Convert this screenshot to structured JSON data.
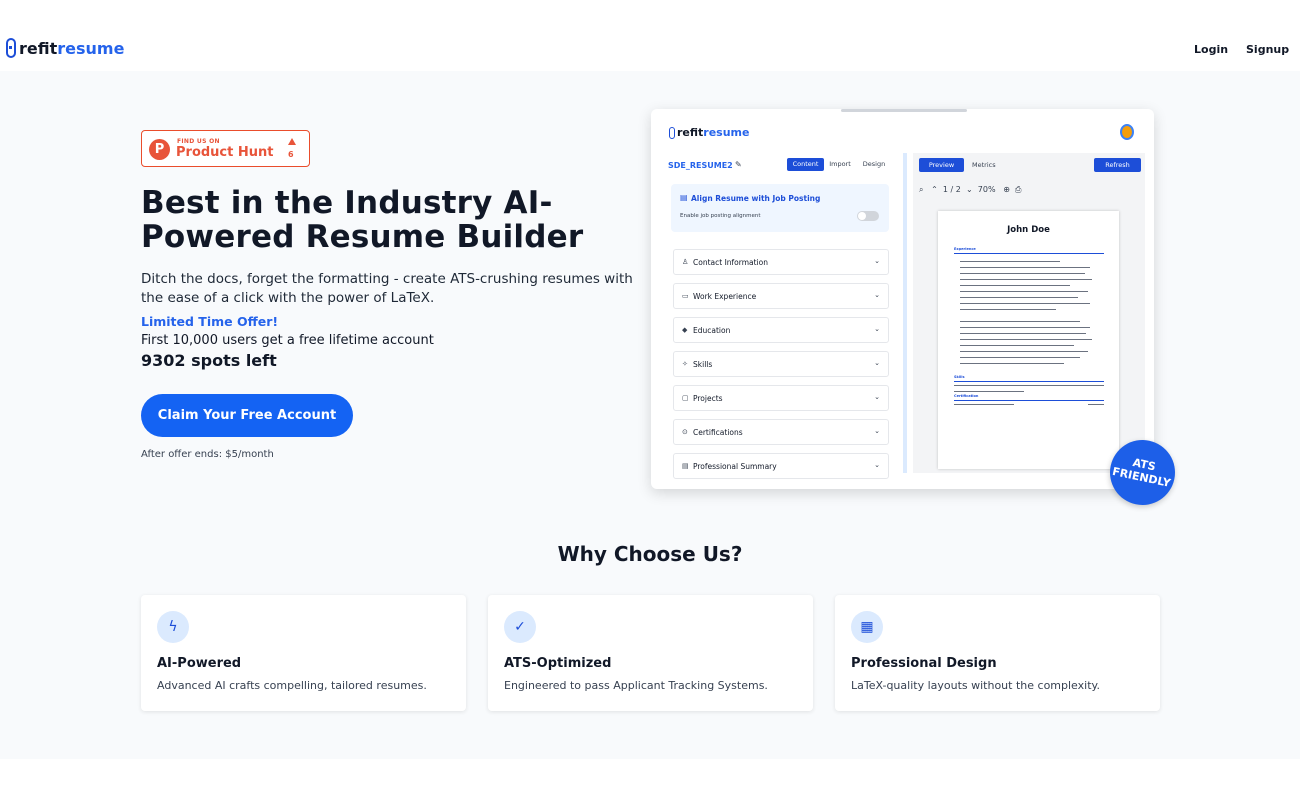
{
  "header": {
    "logo_part1": "refit",
    "logo_part2": "resume",
    "login_label": "Login",
    "signup_label": "Signup"
  },
  "producthunt": {
    "find_text": "FIND US ON",
    "name": "Product Hunt",
    "votes": "6",
    "letter": "P"
  },
  "hero": {
    "title": "Best in the Industry AI-Powered Resume Builder",
    "subtitle": "Ditch the docs, forget the formatting - create ATS-crushing resumes with the ease of a click with the power of LaTeX.",
    "offer": "Limited Time Offer!",
    "first_users": "First 10,000 users get a free lifetime account",
    "spots": "9302 spots left",
    "cta_label": "Claim Your Free Account",
    "after_offer": "After offer ends: $5/month"
  },
  "mock": {
    "logo_part1": "refit",
    "logo_part2": "resume",
    "resume_name": "SDE_RESUME2",
    "tabs": [
      "Content",
      "Import",
      "Design"
    ],
    "align_title": "Align Resume with Job Posting",
    "align_sub": "Enable job posting alignment",
    "sections": [
      "Contact Information",
      "Work Experience",
      "Education",
      "Skills",
      "Projects",
      "Certifications",
      "Professional Summary"
    ],
    "preview_label": "Preview",
    "metrics_label": "Metrics",
    "refresh_label": "Refresh",
    "page_num": "1",
    "page_total": "2",
    "zoom": "70%",
    "resume_title": "John Doe",
    "heading_experience": "Experience",
    "heading_skills": "Skills",
    "heading_certification": "Certification"
  },
  "badge": {
    "line1": "ATS",
    "line2": "FRIENDLY"
  },
  "why": {
    "title": "Why Choose Us?",
    "cards": [
      {
        "title": "AI-Powered",
        "desc": "Advanced AI crafts compelling, tailored resumes.",
        "icon": "lightning-icon"
      },
      {
        "title": "ATS-Optimized",
        "desc": "Engineered to pass Applicant Tracking Systems.",
        "icon": "check-circle-icon"
      },
      {
        "title": "Professional Design",
        "desc": "LaTeX-quality layouts without the complexity.",
        "icon": "layout-icon"
      }
    ]
  },
  "colors": {
    "accent": "#1463f3",
    "producthunt": "#e8543a"
  }
}
